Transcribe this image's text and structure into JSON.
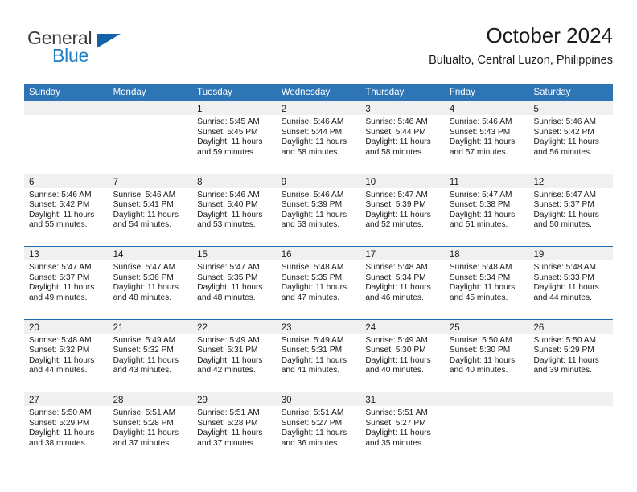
{
  "branding": {
    "logo_primary": "General",
    "logo_secondary": "Blue",
    "logo_icon": "blue-triangle"
  },
  "header": {
    "title": "October 2024",
    "subtitle": "Bulualto, Central Luzon, Philippines"
  },
  "colors": {
    "header_blue": "#2e75b6",
    "row_rule_blue": "#1f6cb0",
    "day_band_gray": "#f0f0f0",
    "logo_blue": "#1f7ec4",
    "text": "#1a1a1a"
  },
  "weekdays": [
    "Sunday",
    "Monday",
    "Tuesday",
    "Wednesday",
    "Thursday",
    "Friday",
    "Saturday"
  ],
  "labels": {
    "sunrise_prefix": "Sunrise:",
    "sunset_prefix": "Sunset:",
    "daylight_prefix": "Daylight:"
  },
  "weeks": [
    [
      {
        "day": "",
        "sunrise": "",
        "sunset": "",
        "daylight_1": "",
        "daylight_2": ""
      },
      {
        "day": "",
        "sunrise": "",
        "sunset": "",
        "daylight_1": "",
        "daylight_2": ""
      },
      {
        "day": "1",
        "sunrise": "Sunrise: 5:45 AM",
        "sunset": "Sunset: 5:45 PM",
        "daylight_1": "Daylight: 11 hours",
        "daylight_2": "and 59 minutes."
      },
      {
        "day": "2",
        "sunrise": "Sunrise: 5:46 AM",
        "sunset": "Sunset: 5:44 PM",
        "daylight_1": "Daylight: 11 hours",
        "daylight_2": "and 58 minutes."
      },
      {
        "day": "3",
        "sunrise": "Sunrise: 5:46 AM",
        "sunset": "Sunset: 5:44 PM",
        "daylight_1": "Daylight: 11 hours",
        "daylight_2": "and 58 minutes."
      },
      {
        "day": "4",
        "sunrise": "Sunrise: 5:46 AM",
        "sunset": "Sunset: 5:43 PM",
        "daylight_1": "Daylight: 11 hours",
        "daylight_2": "and 57 minutes."
      },
      {
        "day": "5",
        "sunrise": "Sunrise: 5:46 AM",
        "sunset": "Sunset: 5:42 PM",
        "daylight_1": "Daylight: 11 hours",
        "daylight_2": "and 56 minutes."
      }
    ],
    [
      {
        "day": "6",
        "sunrise": "Sunrise: 5:46 AM",
        "sunset": "Sunset: 5:42 PM",
        "daylight_1": "Daylight: 11 hours",
        "daylight_2": "and 55 minutes."
      },
      {
        "day": "7",
        "sunrise": "Sunrise: 5:46 AM",
        "sunset": "Sunset: 5:41 PM",
        "daylight_1": "Daylight: 11 hours",
        "daylight_2": "and 54 minutes."
      },
      {
        "day": "8",
        "sunrise": "Sunrise: 5:46 AM",
        "sunset": "Sunset: 5:40 PM",
        "daylight_1": "Daylight: 11 hours",
        "daylight_2": "and 53 minutes."
      },
      {
        "day": "9",
        "sunrise": "Sunrise: 5:46 AM",
        "sunset": "Sunset: 5:39 PM",
        "daylight_1": "Daylight: 11 hours",
        "daylight_2": "and 53 minutes."
      },
      {
        "day": "10",
        "sunrise": "Sunrise: 5:47 AM",
        "sunset": "Sunset: 5:39 PM",
        "daylight_1": "Daylight: 11 hours",
        "daylight_2": "and 52 minutes."
      },
      {
        "day": "11",
        "sunrise": "Sunrise: 5:47 AM",
        "sunset": "Sunset: 5:38 PM",
        "daylight_1": "Daylight: 11 hours",
        "daylight_2": "and 51 minutes."
      },
      {
        "day": "12",
        "sunrise": "Sunrise: 5:47 AM",
        "sunset": "Sunset: 5:37 PM",
        "daylight_1": "Daylight: 11 hours",
        "daylight_2": "and 50 minutes."
      }
    ],
    [
      {
        "day": "13",
        "sunrise": "Sunrise: 5:47 AM",
        "sunset": "Sunset: 5:37 PM",
        "daylight_1": "Daylight: 11 hours",
        "daylight_2": "and 49 minutes."
      },
      {
        "day": "14",
        "sunrise": "Sunrise: 5:47 AM",
        "sunset": "Sunset: 5:36 PM",
        "daylight_1": "Daylight: 11 hours",
        "daylight_2": "and 48 minutes."
      },
      {
        "day": "15",
        "sunrise": "Sunrise: 5:47 AM",
        "sunset": "Sunset: 5:35 PM",
        "daylight_1": "Daylight: 11 hours",
        "daylight_2": "and 48 minutes."
      },
      {
        "day": "16",
        "sunrise": "Sunrise: 5:48 AM",
        "sunset": "Sunset: 5:35 PM",
        "daylight_1": "Daylight: 11 hours",
        "daylight_2": "and 47 minutes."
      },
      {
        "day": "17",
        "sunrise": "Sunrise: 5:48 AM",
        "sunset": "Sunset: 5:34 PM",
        "daylight_1": "Daylight: 11 hours",
        "daylight_2": "and 46 minutes."
      },
      {
        "day": "18",
        "sunrise": "Sunrise: 5:48 AM",
        "sunset": "Sunset: 5:34 PM",
        "daylight_1": "Daylight: 11 hours",
        "daylight_2": "and 45 minutes."
      },
      {
        "day": "19",
        "sunrise": "Sunrise: 5:48 AM",
        "sunset": "Sunset: 5:33 PM",
        "daylight_1": "Daylight: 11 hours",
        "daylight_2": "and 44 minutes."
      }
    ],
    [
      {
        "day": "20",
        "sunrise": "Sunrise: 5:48 AM",
        "sunset": "Sunset: 5:32 PM",
        "daylight_1": "Daylight: 11 hours",
        "daylight_2": "and 44 minutes."
      },
      {
        "day": "21",
        "sunrise": "Sunrise: 5:49 AM",
        "sunset": "Sunset: 5:32 PM",
        "daylight_1": "Daylight: 11 hours",
        "daylight_2": "and 43 minutes."
      },
      {
        "day": "22",
        "sunrise": "Sunrise: 5:49 AM",
        "sunset": "Sunset: 5:31 PM",
        "daylight_1": "Daylight: 11 hours",
        "daylight_2": "and 42 minutes."
      },
      {
        "day": "23",
        "sunrise": "Sunrise: 5:49 AM",
        "sunset": "Sunset: 5:31 PM",
        "daylight_1": "Daylight: 11 hours",
        "daylight_2": "and 41 minutes."
      },
      {
        "day": "24",
        "sunrise": "Sunrise: 5:49 AM",
        "sunset": "Sunset: 5:30 PM",
        "daylight_1": "Daylight: 11 hours",
        "daylight_2": "and 40 minutes."
      },
      {
        "day": "25",
        "sunrise": "Sunrise: 5:50 AM",
        "sunset": "Sunset: 5:30 PM",
        "daylight_1": "Daylight: 11 hours",
        "daylight_2": "and 40 minutes."
      },
      {
        "day": "26",
        "sunrise": "Sunrise: 5:50 AM",
        "sunset": "Sunset: 5:29 PM",
        "daylight_1": "Daylight: 11 hours",
        "daylight_2": "and 39 minutes."
      }
    ],
    [
      {
        "day": "27",
        "sunrise": "Sunrise: 5:50 AM",
        "sunset": "Sunset: 5:29 PM",
        "daylight_1": "Daylight: 11 hours",
        "daylight_2": "and 38 minutes."
      },
      {
        "day": "28",
        "sunrise": "Sunrise: 5:51 AM",
        "sunset": "Sunset: 5:28 PM",
        "daylight_1": "Daylight: 11 hours",
        "daylight_2": "and 37 minutes."
      },
      {
        "day": "29",
        "sunrise": "Sunrise: 5:51 AM",
        "sunset": "Sunset: 5:28 PM",
        "daylight_1": "Daylight: 11 hours",
        "daylight_2": "and 37 minutes."
      },
      {
        "day": "30",
        "sunrise": "Sunrise: 5:51 AM",
        "sunset": "Sunset: 5:27 PM",
        "daylight_1": "Daylight: 11 hours",
        "daylight_2": "and 36 minutes."
      },
      {
        "day": "31",
        "sunrise": "Sunrise: 5:51 AM",
        "sunset": "Sunset: 5:27 PM",
        "daylight_1": "Daylight: 11 hours",
        "daylight_2": "and 35 minutes."
      },
      {
        "day": "",
        "sunrise": "",
        "sunset": "",
        "daylight_1": "",
        "daylight_2": ""
      },
      {
        "day": "",
        "sunrise": "",
        "sunset": "",
        "daylight_1": "",
        "daylight_2": ""
      }
    ]
  ]
}
